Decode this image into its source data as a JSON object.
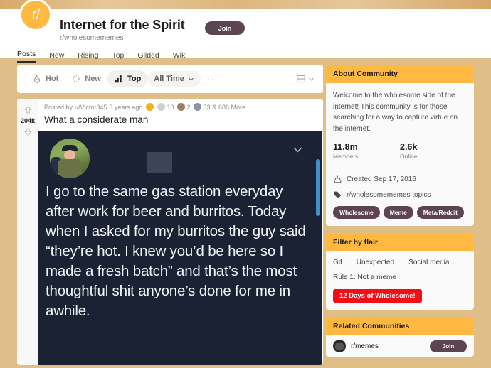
{
  "community": {
    "title": "Internet for the Spirit",
    "subreddit": "r/wholesomememes",
    "join_label": "Join",
    "avatar_glyph": "r/"
  },
  "nav": {
    "tabs": [
      {
        "label": "Posts",
        "active": true
      },
      {
        "label": "New",
        "active": false
      },
      {
        "label": "Rising",
        "active": false
      },
      {
        "label": "Top",
        "active": false
      },
      {
        "label": "Gilded",
        "active": false
      },
      {
        "label": "Wiki",
        "active": false
      }
    ]
  },
  "sortbar": {
    "hot": "Hot",
    "new": "New",
    "top": "Top",
    "time_filter": "All Time",
    "more_label": "···"
  },
  "post": {
    "vote_count": "204k",
    "posted_by_prefix": "Posted by",
    "author": "u/Victor345",
    "timestamp": "3 years ago",
    "title": "What a considerate man",
    "awards": [
      {
        "name": "gold-award",
        "color": "#f2b01e",
        "count": ""
      },
      {
        "name": "silver-award",
        "color": "#c7d1d8",
        "count": "10"
      },
      {
        "name": "helpful-award",
        "color": "#9e7e62",
        "count": "2"
      },
      {
        "name": "wholesome-award",
        "color": "#8a93a8",
        "count": "33"
      }
    ],
    "more_awards": "& 686 More",
    "meme_text": "I go to the same gas station everyday after work for beer and burritos. Today when I asked for my burritos the guy said “they’re hot. I knew you’d be here so I made a fresh batch” and that’s the most thoughtful shit anyone’s done for me in awhile."
  },
  "sidebar": {
    "about": {
      "heading": "About Community",
      "description": "Welcome to the wholesome side of the internet! This community is for those searching for a way to capture virtue on the internet.",
      "members_count": "11.8m",
      "members_label": "Members",
      "online_count": "2.6k",
      "online_label": "Online",
      "created": "Created Sep 17, 2016",
      "topics_label": "r/wholesomememes topics",
      "topics": [
        "Wholesome",
        "Meme",
        "Meta/Reddit"
      ]
    },
    "flair": {
      "heading": "Filter by flair",
      "items": [
        "Gif",
        "Unexpected",
        "Social media",
        "Rule 1: Not a meme"
      ],
      "badge": "12 Days of Wholesome!"
    },
    "related": {
      "heading": "Related Communities",
      "items": [
        {
          "name": "r/memes",
          "join_label": "Join"
        }
      ]
    }
  },
  "colors": {
    "page_background": "#e0be88",
    "accent_orange": "#ffb940",
    "pill_plum": "#5d4450",
    "flair_red": "#f40d15",
    "meme_background": "#1a2233"
  }
}
